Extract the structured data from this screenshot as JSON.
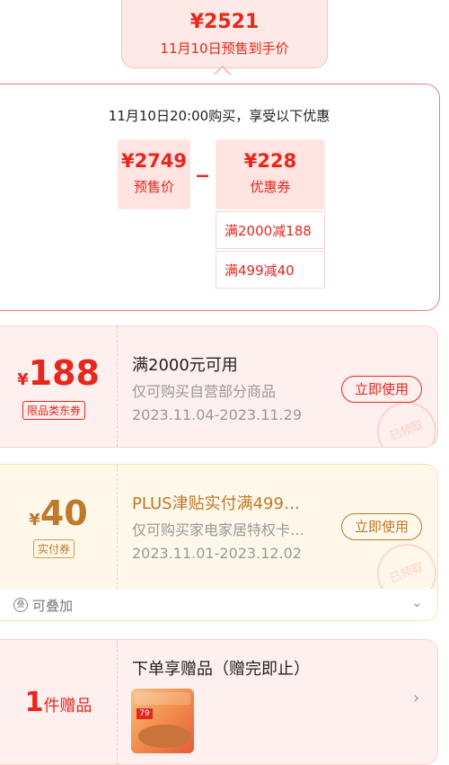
{
  "presale": {
    "price": "¥2521",
    "label": "11月10日预售到手价"
  },
  "breakdown": {
    "title": "11月10日20:00购买，享受以下优惠",
    "presale_price": "¥2749",
    "presale_label": "预售价",
    "operator": "_",
    "coupon_value": "¥228",
    "coupon_label": "优惠券",
    "rules": [
      "满2000减188",
      "满499减40"
    ]
  },
  "coupons": [
    {
      "currency": "¥",
      "amount": "188",
      "tag": "限品类东券",
      "title": "满2000元可用",
      "desc": "仅可购买自营部分商品",
      "date": "2023.11.04-2023.11.29",
      "button": "立即使用",
      "stamp": "已领取",
      "accent": "#e8261c"
    },
    {
      "currency": "¥",
      "amount": "40",
      "tag": "实付券",
      "title": "PLUS津贴实付满499…",
      "desc": "仅可购买家电家居特权卡…",
      "date": "2023.11.01-2023.12.02",
      "button": "立即使用",
      "stamp": "已领取",
      "accent": "#c0782a"
    }
  ],
  "stackable": {
    "icon_glyph": "叠",
    "label": "可叠加",
    "chevron": "⌄"
  },
  "gift": {
    "count": "1",
    "unit": "件赠品",
    "title": "下单享赠品（赠完即止）",
    "thumb_badge": "79",
    "chevron": "›"
  }
}
